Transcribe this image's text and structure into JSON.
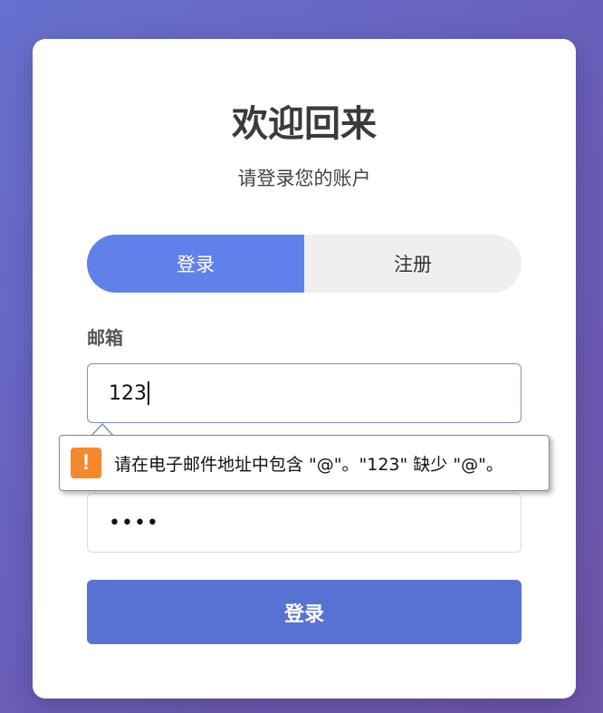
{
  "header": {
    "title": "欢迎回来",
    "subtitle": "请登录您的账户"
  },
  "tabs": [
    {
      "label": "登录",
      "active": true
    },
    {
      "label": "注册",
      "active": false
    }
  ],
  "form": {
    "email_label": "邮箱",
    "email_value": "123",
    "password_value": "••••",
    "submit_label": "登录"
  },
  "validation": {
    "icon": "warning-icon",
    "icon_glyph": "!",
    "message": "请在电子邮件地址中包含 \"@\"。\"123\" 缺少 \"@\"。"
  },
  "colors": {
    "accent": "#6180ea",
    "submit": "#5772d2",
    "warning": "#f5892b"
  }
}
